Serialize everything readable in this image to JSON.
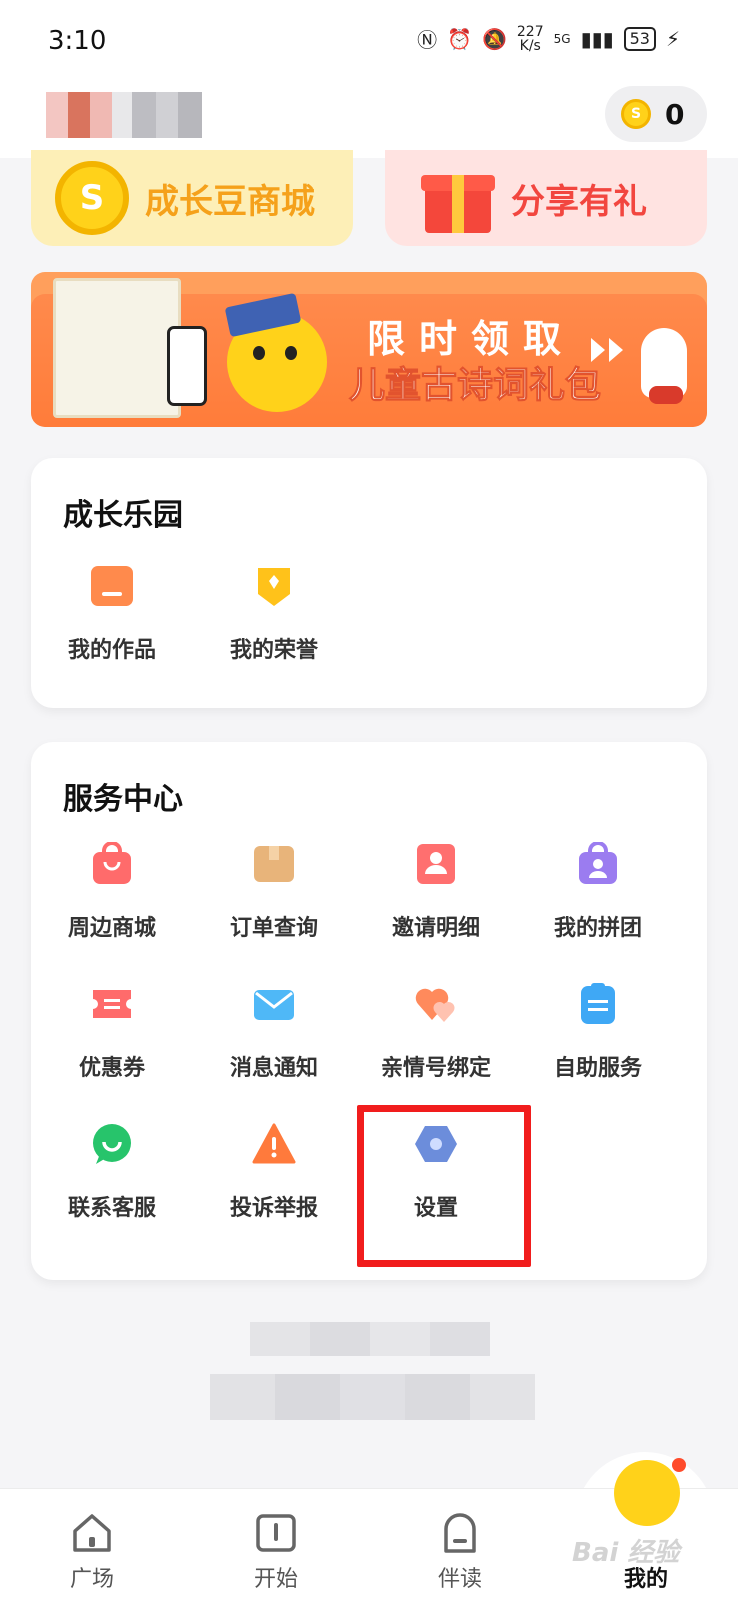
{
  "status_bar": {
    "time": "3:10",
    "speed_value": "227",
    "speed_unit": "K/s",
    "network": "5G",
    "battery": "53"
  },
  "header": {
    "coin_count": "0"
  },
  "promo": {
    "mall_label": "成长豆商城",
    "share_label": "分享有礼"
  },
  "banner": {
    "line1": [
      "限",
      "时",
      "领",
      "取"
    ],
    "line2": "儿童古诗词礼包"
  },
  "growth_park": {
    "title": "成长乐园",
    "items": [
      {
        "label": "我的作品",
        "icon": "works-icon",
        "color": "#ff8a4c"
      },
      {
        "label": "我的荣誉",
        "icon": "honor-icon",
        "color": "#ffc21a"
      }
    ]
  },
  "service_center": {
    "title": "服务中心",
    "items": [
      {
        "label": "周边商城",
        "icon": "shopping-bag-icon",
        "color": "#ff6b6b"
      },
      {
        "label": "订单查询",
        "icon": "package-icon",
        "color": "#e8b47a"
      },
      {
        "label": "邀请明细",
        "icon": "invite-icon",
        "color": "#ff6f6f"
      },
      {
        "label": "我的拼团",
        "icon": "group-buy-icon",
        "color": "#9b7cf0"
      },
      {
        "label": "优惠券",
        "icon": "coupon-icon",
        "color": "#ff6b6b"
      },
      {
        "label": "消息通知",
        "icon": "mail-icon",
        "color": "#4fb8f7"
      },
      {
        "label": "亲情号绑定",
        "icon": "heart-icon",
        "color": "#ff8a5c"
      },
      {
        "label": "自助服务",
        "icon": "clipboard-icon",
        "color": "#3fa8f5"
      },
      {
        "label": "联系客服",
        "icon": "chat-icon",
        "color": "#27c46b"
      },
      {
        "label": "投诉举报",
        "icon": "warning-icon",
        "color": "#ff7a3c"
      },
      {
        "label": "设置",
        "icon": "settings-hexagon-icon",
        "color": "#6c8ddb"
      }
    ]
  },
  "tabs": [
    {
      "label": "广场",
      "icon": "home-icon"
    },
    {
      "label": "开始",
      "icon": "book-icon"
    },
    {
      "label": "伴读",
      "icon": "backpack-icon"
    },
    {
      "label": "我的",
      "icon": "chick-avatar-icon"
    }
  ],
  "watermark": "Bai 经验"
}
